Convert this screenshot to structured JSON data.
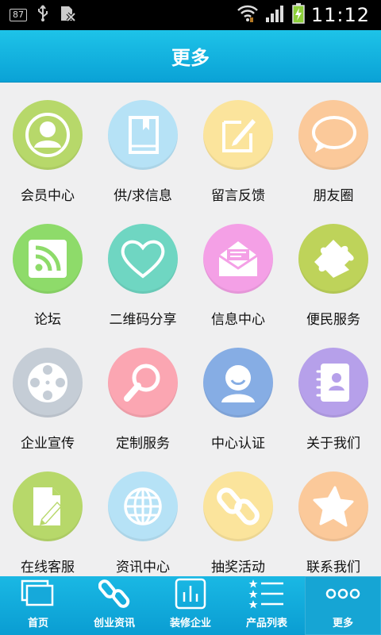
{
  "status_bar": {
    "battery_level": "87",
    "time": "11:12"
  },
  "header": {
    "title": "更多"
  },
  "grid": {
    "items": [
      {
        "label": "会员中心",
        "icon": "member-icon",
        "color": "#b7d86a"
      },
      {
        "label": "供/求信息",
        "icon": "book-icon",
        "color": "#b6e2f6"
      },
      {
        "label": "留言反馈",
        "icon": "note-edit-icon",
        "color": "#fbe49c"
      },
      {
        "label": "朋友圈",
        "icon": "speech-bubble-icon",
        "color": "#fbc99a"
      },
      {
        "label": "论坛",
        "icon": "rss-icon",
        "color": "#8edb6a"
      },
      {
        "label": "二维码分享",
        "icon": "heart-icon",
        "color": "#6fd6c2"
      },
      {
        "label": "信息中心",
        "icon": "mail-icon",
        "color": "#f4a0e6"
      },
      {
        "label": "便民服务",
        "icon": "puzzle-icon",
        "color": "#bed35a"
      },
      {
        "label": "企业宣传",
        "icon": "film-reel-icon",
        "color": "#c5cdd6"
      },
      {
        "label": "定制服务",
        "icon": "magnifier-icon",
        "color": "#fba6b2"
      },
      {
        "label": "中心认证",
        "icon": "user-badge-icon",
        "color": "#86ade4"
      },
      {
        "label": "关于我们",
        "icon": "contact-book-icon",
        "color": "#b6a0ea"
      },
      {
        "label": "在线客服",
        "icon": "document-pen-icon",
        "color": "#b7d86a"
      },
      {
        "label": "资讯中心",
        "icon": "globe-icon",
        "color": "#b6e2f6"
      },
      {
        "label": "抽奖活动",
        "icon": "link-icon",
        "color": "#fbe49c"
      },
      {
        "label": "联系我们",
        "icon": "star-icon",
        "color": "#fbc99a"
      }
    ]
  },
  "tab_bar": {
    "tabs": [
      {
        "label": "首页",
        "icon": "home-window-icon"
      },
      {
        "label": "创业资讯",
        "icon": "link-icon"
      },
      {
        "label": "装修企业",
        "icon": "bar-chart-icon"
      },
      {
        "label": "产品列表",
        "icon": "star-list-icon"
      },
      {
        "label": "更多",
        "icon": "more-dots-icon",
        "active": true
      }
    ]
  }
}
